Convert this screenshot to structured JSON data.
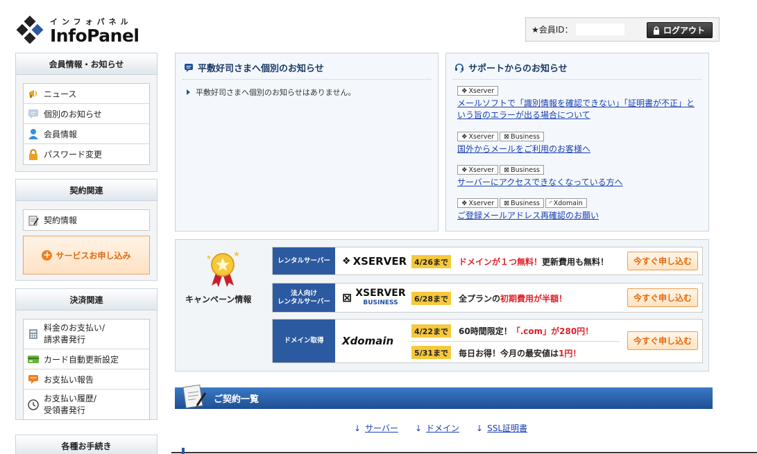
{
  "header": {
    "logo_kana": "インフォパネル",
    "logo_name": "InfoPanel",
    "member_label": "★会員ID：",
    "logout_label": "ログアウト"
  },
  "sidebar": {
    "member_section": {
      "title": "会員情報・お知らせ",
      "items": [
        {
          "label": "ニュース",
          "icon": "megaphone-icon"
        },
        {
          "label": "個別のお知らせ",
          "icon": "message-icon"
        },
        {
          "label": "会員情報",
          "icon": "user-icon"
        },
        {
          "label": "パスワード変更",
          "icon": "lock-icon"
        }
      ]
    },
    "contract_section": {
      "title": "契約関連",
      "items": [
        {
          "label": "契約情報",
          "icon": "contract-icon"
        }
      ],
      "apply_label": "サービスお申し込み"
    },
    "payment_section": {
      "title": "決済関連",
      "items": [
        {
          "label1": "料金のお支払い/",
          "label2": "請求書発行",
          "icon": "calculator-icon"
        },
        {
          "label": "カード自動更新設定",
          "icon": "card-icon"
        },
        {
          "label": "お支払い報告",
          "icon": "chat-icon"
        },
        {
          "label1": "お支払い履歴/",
          "label2": "受領書発行",
          "icon": "clock-icon"
        }
      ]
    },
    "procedures_section": {
      "title": "各種お手続き"
    }
  },
  "personal_notice": {
    "title": "平敷好司さまへ個別のお知らせ",
    "message": "平敷好司さまへ個別のお知らせはありません。"
  },
  "support_notice": {
    "title": "サポートからのお知らせ",
    "items": [
      {
        "tags": [
          "Xserver"
        ],
        "text": "メールソフトで「識別情報を確認できない」「証明書が不正」という旨のエラーが出る場合について"
      },
      {
        "tags": [
          "Xserver",
          "Business"
        ],
        "text": "国外からメールをご利用のお客様へ"
      },
      {
        "tags": [
          "Xserver",
          "Business"
        ],
        "text": "サーバーにアクセスできなくなっている方へ"
      },
      {
        "tags": [
          "Xserver",
          "Business",
          "Xdomain"
        ],
        "text": "ご登録メールアドレス再確認のお願い"
      }
    ]
  },
  "campaign": {
    "label": "キャンペーン情報",
    "rows": [
      {
        "category": "レンタルサーバー",
        "logo": "XSERVER",
        "date": "4/26まで",
        "promo_red": "ドメインが１つ無料！",
        "promo_black": "更新費用も無料！",
        "button": "今すぐ申し込む"
      },
      {
        "category1": "法人向け",
        "category2": "レンタルサーバー",
        "logo": "XSERVER",
        "logo_sub": "BUSINESS",
        "date": "6/28まで",
        "promo_pre": "全プランの",
        "promo_red": "初期費用が半額！",
        "button": "今すぐ申し込む"
      },
      {
        "category": "ドメイン取得",
        "logo": "Xdomain",
        "date1": "4/22まで",
        "promo1_pre": "60時間限定！",
        "promo1_red": "「.com」が280円！",
        "date2": "5/31まで",
        "promo2_pre": "毎日お得！今月の最安値は",
        "promo2_red": "1円！",
        "button": "今すぐ申し込む"
      }
    ]
  },
  "contracts": {
    "title": "ご契約一覧",
    "links": [
      "サーバー",
      "ドメイン",
      "SSL証明書"
    ]
  },
  "colors": {
    "accent_blue": "#2c5aa0",
    "orange": "#e06a10",
    "badge_yellow": "#f6c83a",
    "promo_red": "#e0202a"
  }
}
